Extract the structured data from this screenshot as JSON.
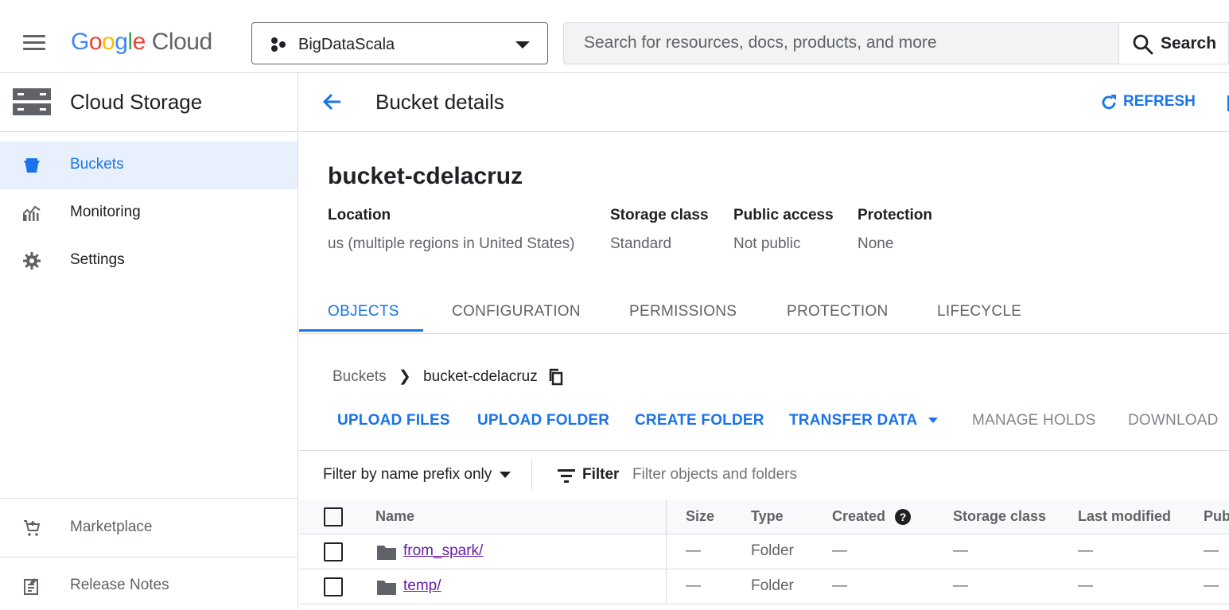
{
  "header": {
    "logo_text": "Google",
    "logo_product": "Cloud",
    "project_name": "BigDataScala",
    "search_placeholder": "Search for resources, docs, products, and more",
    "search_button": "Search"
  },
  "sidebar": {
    "title": "Cloud Storage",
    "items": [
      {
        "label": "Buckets",
        "icon": "bucket-icon",
        "active": true
      },
      {
        "label": "Monitoring",
        "icon": "monitoring-icon",
        "active": false
      },
      {
        "label": "Settings",
        "icon": "gear-icon",
        "active": false
      }
    ],
    "footer_items": [
      {
        "label": "Marketplace",
        "icon": "marketplace-cart-icon"
      },
      {
        "label": "Release Notes",
        "icon": "release-notes-icon"
      }
    ]
  },
  "page": {
    "title": "Bucket details",
    "refresh": "REFRESH",
    "bucket_name": "bucket-cdelacruz",
    "meta": [
      {
        "key": "Location",
        "value": "us (multiple regions in United States)"
      },
      {
        "key": "Storage class",
        "value": "Standard"
      },
      {
        "key": "Public access",
        "value": "Not public"
      },
      {
        "key": "Protection",
        "value": "None"
      }
    ],
    "tabs": [
      "OBJECTS",
      "CONFIGURATION",
      "PERMISSIONS",
      "PROTECTION",
      "LIFECYCLE"
    ],
    "active_tab": "OBJECTS",
    "breadcrumb": {
      "root": "Buckets",
      "current": "bucket-cdelacruz"
    },
    "actions": {
      "upload_files": "UPLOAD FILES",
      "upload_folder": "UPLOAD FOLDER",
      "create_folder": "CREATE FOLDER",
      "transfer_data": "TRANSFER DATA",
      "manage_holds": "MANAGE HOLDS",
      "download": "DOWNLOAD"
    },
    "filter": {
      "mode": "Filter by name prefix only",
      "label": "Filter",
      "placeholder": "Filter objects and folders"
    },
    "table": {
      "columns": [
        "Name",
        "Size",
        "Type",
        "Created",
        "Storage class",
        "Last modified",
        "Pub"
      ],
      "rows": [
        {
          "name": "from_spark/",
          "size": "—",
          "type": "Folder",
          "created": "—",
          "storage_class": "—",
          "last_modified": "—",
          "pub": "—"
        },
        {
          "name": "temp/",
          "size": "—",
          "type": "Folder",
          "created": "—",
          "storage_class": "—",
          "last_modified": "—",
          "pub": "—"
        }
      ]
    }
  },
  "colors": {
    "accent": "#1a73e8",
    "active_bg": "#e8f0fe",
    "link_visited": "#681da8",
    "text": "#202124",
    "muted": "#5f6368"
  }
}
